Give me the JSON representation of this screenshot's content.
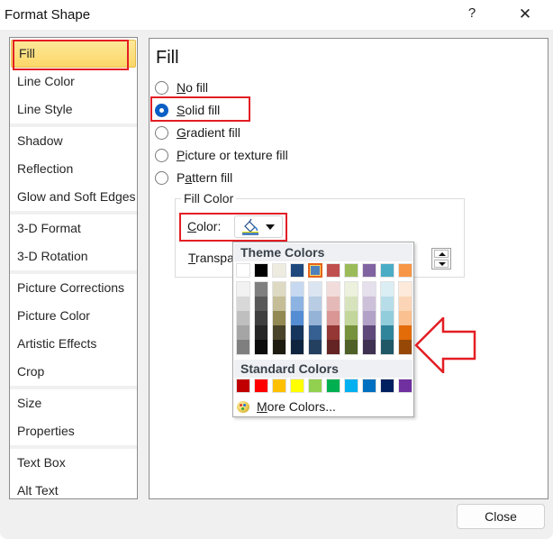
{
  "window": {
    "title": "Format Shape",
    "help_label": "?",
    "close_label": "✕"
  },
  "sidebar": {
    "groups": [
      [
        {
          "label": "Fill",
          "active": true
        },
        {
          "label": "Line Color"
        },
        {
          "label": "Line Style"
        }
      ],
      [
        {
          "label": "Shadow"
        },
        {
          "label": "Reflection"
        },
        {
          "label": "Glow and Soft Edges"
        }
      ],
      [
        {
          "label": "3-D Format"
        },
        {
          "label": "3-D Rotation"
        }
      ],
      [
        {
          "label": "Picture Corrections"
        },
        {
          "label": "Picture Color"
        },
        {
          "label": "Artistic Effects"
        },
        {
          "label": "Crop"
        }
      ],
      [
        {
          "label": "Size"
        },
        {
          "label": "Properties"
        }
      ],
      [
        {
          "label": "Text Box"
        },
        {
          "label": "Alt Text"
        }
      ]
    ]
  },
  "panel": {
    "title": "Fill",
    "fill_options": [
      {
        "label": "No fill",
        "mnemonic": "N",
        "checked": false
      },
      {
        "label": "Solid fill",
        "mnemonic": "S",
        "checked": true
      },
      {
        "label": "Gradient fill",
        "mnemonic": "G",
        "checked": false
      },
      {
        "label": "Picture or texture fill",
        "mnemonic": "P",
        "checked": false
      },
      {
        "label": "Pattern fill",
        "mnemonic": "a",
        "checked": false
      }
    ],
    "fill_color_legend": "Fill Color",
    "color_label": "Color:",
    "color_mnemonic": "C",
    "current_color": "#4f81bd",
    "transparency_label_visible": "Transpa",
    "transparency_mnemonic": "T"
  },
  "color_picker": {
    "theme_colors_label": "Theme Colors",
    "standard_colors_label": "Standard Colors",
    "more_colors_label": "More Colors...",
    "more_colors_mnemonic": "M",
    "selected_theme_index": 4,
    "theme_colors": [
      "#ffffff",
      "#000000",
      "#eeece1",
      "#1f497d",
      "#4f81bd",
      "#c0504d",
      "#9bbb59",
      "#8064a2",
      "#4bacc6",
      "#f79646"
    ],
    "theme_shades": [
      [
        "#f2f2f2",
        "#d8d8d8",
        "#bfbfbf",
        "#a5a5a5",
        "#7f7f7f"
      ],
      [
        "#7f7f7f",
        "#595959",
        "#3f3f3f",
        "#262626",
        "#0c0c0c"
      ],
      [
        "#ddd9c3",
        "#c4bd97",
        "#938953",
        "#494429",
        "#1d1b10"
      ],
      [
        "#c6d9f0",
        "#8db3e2",
        "#548dd4",
        "#17365d",
        "#0f243e"
      ],
      [
        "#dbe5f1",
        "#b8cce4",
        "#95b3d7",
        "#366092",
        "#244061"
      ],
      [
        "#f2dcdb",
        "#e5b9b7",
        "#d99694",
        "#953734",
        "#632423"
      ],
      [
        "#ebf1dd",
        "#d7e3bc",
        "#c3d69b",
        "#76923c",
        "#4f6128"
      ],
      [
        "#e5e0ec",
        "#ccc1d9",
        "#b2a2c7",
        "#5f497a",
        "#3f3151"
      ],
      [
        "#dbeef3",
        "#b7dde8",
        "#92cddc",
        "#31859b",
        "#205867"
      ],
      [
        "#fdeada",
        "#fbd5b5",
        "#fac08f",
        "#e36c09",
        "#974806"
      ]
    ],
    "standard_colors": [
      "#c00000",
      "#ff0000",
      "#ffc000",
      "#ffff00",
      "#92d050",
      "#00b050",
      "#00b0f0",
      "#0070c0",
      "#002060",
      "#7030a0"
    ]
  },
  "annotation": {
    "highlight_color": "#e31e24"
  },
  "footer": {
    "close_button_label": "Close"
  }
}
